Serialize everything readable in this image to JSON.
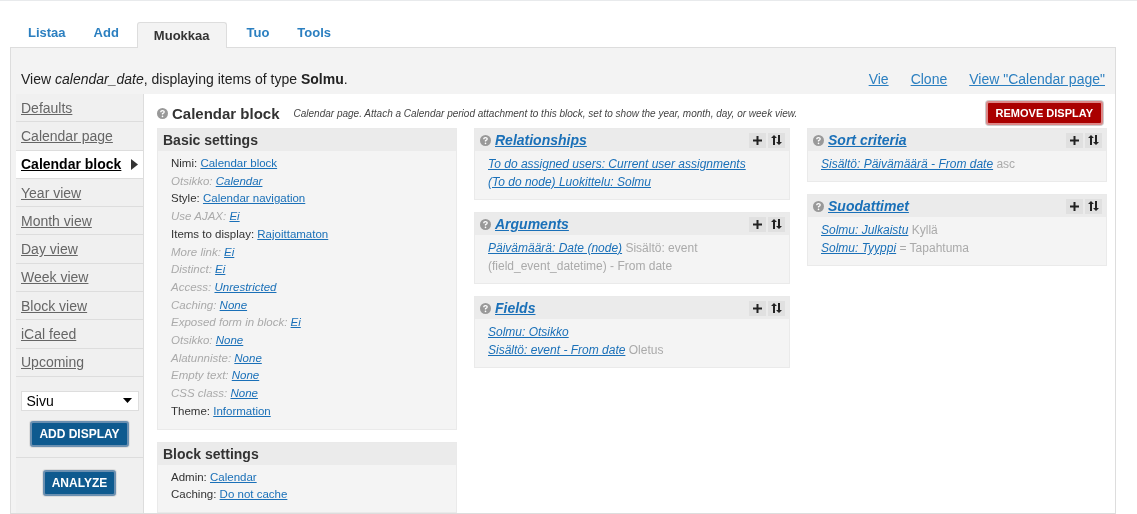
{
  "tabs": [
    {
      "label": "Listaa",
      "selected": false
    },
    {
      "label": "Add",
      "selected": false
    },
    {
      "label": "Muokkaa",
      "selected": true
    },
    {
      "label": "Tuo",
      "selected": false
    },
    {
      "label": "Tools",
      "selected": false
    }
  ],
  "header": {
    "text": "View *calendar_date*, displaying items of type **Solmu**.",
    "links": [
      "Vie",
      "Clone",
      "View \"Calendar page\""
    ]
  },
  "displays": [
    {
      "label": "Defaults",
      "selected": false
    },
    {
      "label": "Calendar page",
      "selected": false
    },
    {
      "label": "Calendar block",
      "selected": true
    },
    {
      "label": "Year view",
      "selected": false
    },
    {
      "label": "Month view",
      "selected": false
    },
    {
      "label": "Day view",
      "selected": false
    },
    {
      "label": "Week view",
      "selected": false
    },
    {
      "label": "Block view",
      "selected": false
    },
    {
      "label": "iCal feed",
      "selected": false
    },
    {
      "label": "Upcoming",
      "selected": false
    }
  ],
  "display_type": {
    "value": "Sivu"
  },
  "add_display_button": "ADD DISPLAY",
  "analyze_button": "ANALYZE",
  "display": {
    "title": "Calendar block",
    "description": "Calendar page. Attach a Calendar period attachment to this block, set to show the year, month, day, or week view.",
    "remove_button": "REMOVE DISPLAY"
  },
  "settings_groups": [
    {
      "title": "Basic settings",
      "settings": [
        {
          "label": "Nimi:",
          "value": "Calendar block",
          "overridden": true
        },
        {
          "label": "Otsikko:",
          "value": "Calendar",
          "overridden": false
        },
        {
          "label": "Style:",
          "value": "Calendar navigation",
          "overridden": true
        },
        {
          "label": "Use AJAX:",
          "value": "Ei",
          "overridden": false
        },
        {
          "label": "Items to display:",
          "value": "Rajoittamaton",
          "overridden": true
        },
        {
          "label": "More link:",
          "value": "Ei",
          "overridden": false
        },
        {
          "label": "Distinct:",
          "value": "Ei",
          "overridden": false
        },
        {
          "label": "Access:",
          "value": "Unrestricted",
          "overridden": false
        },
        {
          "label": "Caching:",
          "value": "None",
          "overridden": false
        },
        {
          "label": "Exposed form in block:",
          "value": "Ei",
          "overridden": false
        },
        {
          "label": "Otsikko:",
          "value": "None",
          "overridden": false
        },
        {
          "label": "Alatunniste:",
          "value": "None",
          "overridden": false
        },
        {
          "label": "Empty text:",
          "value": "None",
          "overridden": false
        },
        {
          "label": "CSS class:",
          "value": "None",
          "overridden": false
        },
        {
          "label": "Theme:",
          "value": "Information",
          "overridden": true
        }
      ]
    },
    {
      "title": "Block settings",
      "settings": [
        {
          "label": "Admin:",
          "value": "Calendar",
          "overridden": true
        },
        {
          "label": "Caching:",
          "value": "Do not cache",
          "overridden": true
        }
      ]
    }
  ],
  "columns": [
    [
      {
        "title": "Relationships",
        "items": [
          {
            "link": "To do assigned users: Current user assignments"
          },
          {
            "link": "(To do node) Luokittelu: Solmu"
          }
        ]
      },
      {
        "title": "Arguments",
        "items": [
          {
            "link": "Päivämäärä: Date (node)",
            "note": "Sisältö: event (field_event_datetime) - From date"
          }
        ]
      },
      {
        "title": "Fields",
        "items": [
          {
            "link": "Solmu: Otsikko"
          },
          {
            "link": "Sisältö: event - From date",
            "note": "Oletus"
          }
        ]
      }
    ],
    [
      {
        "title": "Sort criteria",
        "items": [
          {
            "link": "Sisältö: Päivämäärä - From date",
            "note": "asc"
          }
        ]
      },
      {
        "title": "Suodattimet",
        "items": [
          {
            "link": "Solmu: Julkaistu",
            "note": "Kyllä"
          },
          {
            "link": "Solmu: Tyyppi",
            "note": "= Tapahtuma"
          }
        ]
      }
    ]
  ]
}
